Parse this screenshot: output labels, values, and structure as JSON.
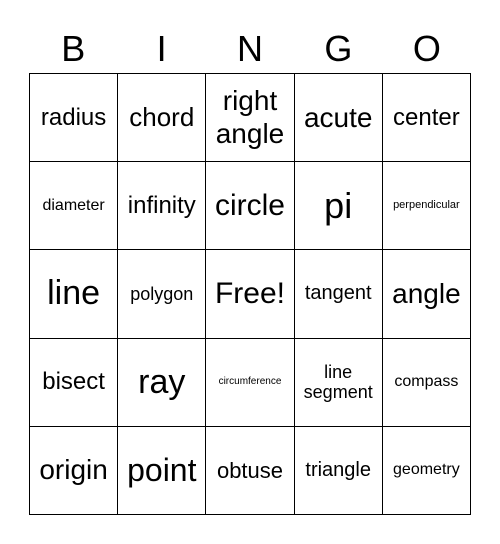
{
  "header": [
    "B",
    "I",
    "N",
    "G",
    "O"
  ],
  "cells": [
    [
      "radius",
      "chord",
      "right angle",
      "acute",
      "center"
    ],
    [
      "diameter",
      "infinity",
      "circle",
      "pi",
      "perpendicular"
    ],
    [
      "line",
      "polygon",
      "Free!",
      "tangent",
      "angle"
    ],
    [
      "bisect",
      "ray",
      "circumference",
      "line segment",
      "compass"
    ],
    [
      "origin",
      "point",
      "obtuse",
      "triangle",
      "geometry"
    ]
  ]
}
